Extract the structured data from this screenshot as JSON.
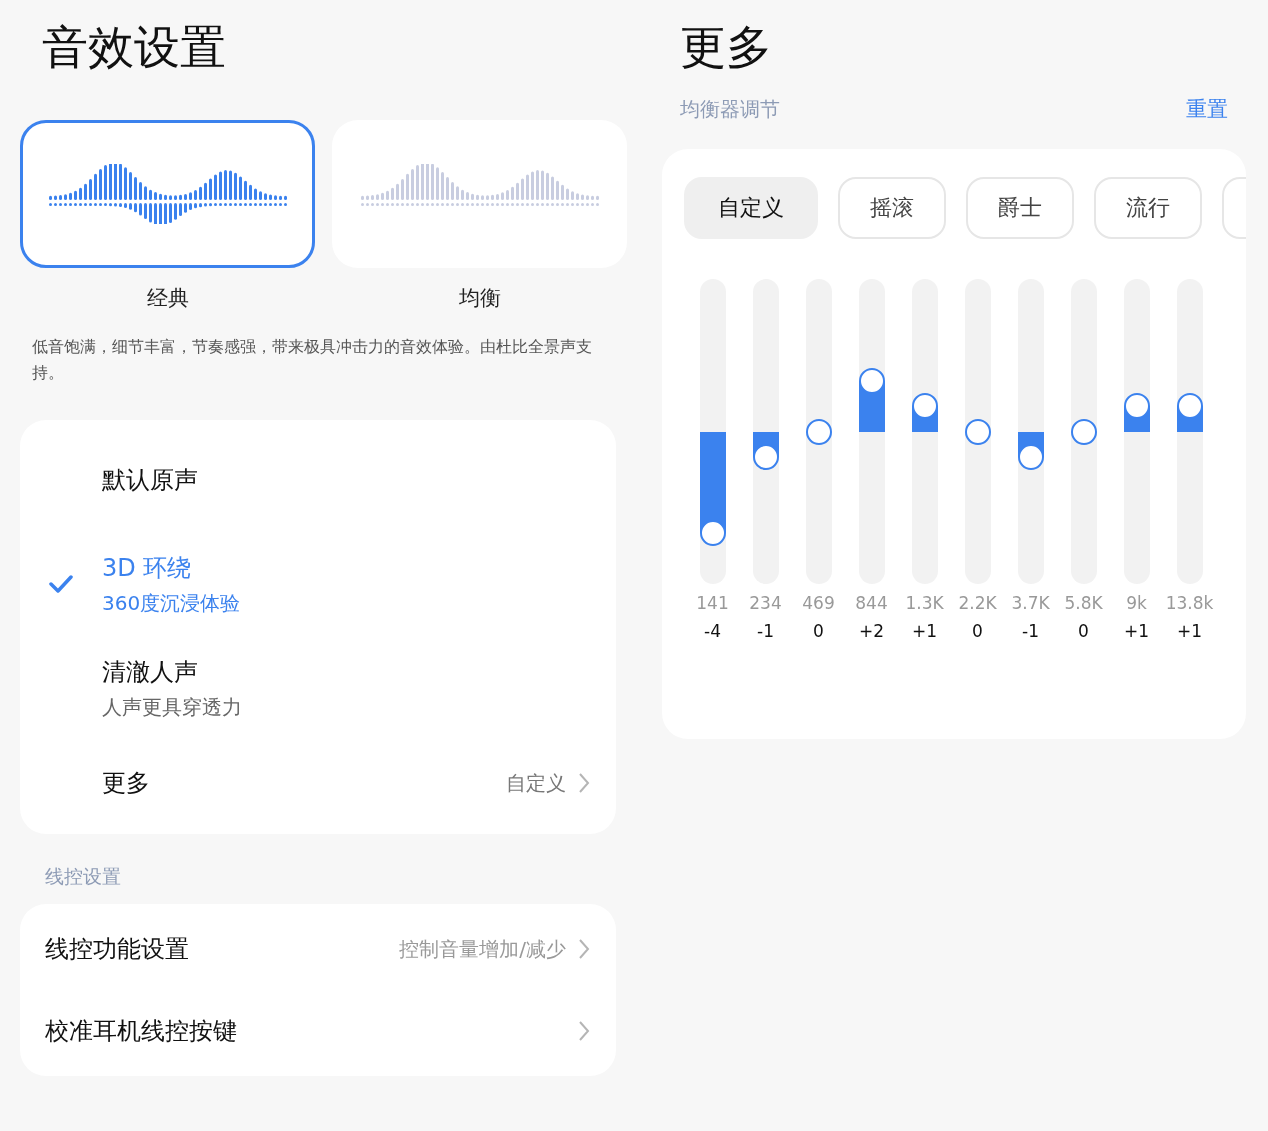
{
  "left": {
    "title": "音效设置",
    "styles": [
      {
        "label": "经典",
        "selected": true
      },
      {
        "label": "均衡",
        "selected": false
      }
    ],
    "description": "低音饱满，细节丰富，节奏感强，带来极具冲击力的音效体验。由杜比全景声支持。",
    "modes": [
      {
        "kind": "mode",
        "title": "默认原声",
        "selected": false
      },
      {
        "kind": "mode",
        "title": "3D 环绕",
        "subtitle": "360度沉浸体验",
        "selected": true
      },
      {
        "kind": "mode",
        "title": "清澈人声",
        "subtitle": "人声更具穿透力",
        "selected": false
      },
      {
        "kind": "link",
        "title": "更多",
        "value": "自定义"
      }
    ],
    "wire_section": "线控设置",
    "wire_rows": [
      {
        "title": "线控功能设置",
        "value": "控制音量增加/减少"
      },
      {
        "title": "校准耳机线控按键"
      }
    ]
  },
  "right": {
    "title": "更多",
    "eq_label": "均衡器调节",
    "reset": "重置",
    "presets": [
      {
        "label": "自定义",
        "selected": true
      },
      {
        "label": "摇滚",
        "selected": false
      },
      {
        "label": "爵士",
        "selected": false
      },
      {
        "label": "流行",
        "selected": false
      }
    ],
    "bands": [
      {
        "freq": "141",
        "gain": "-4",
        "level": 0.1667
      },
      {
        "freq": "234",
        "gain": "-1",
        "level": 0.4167
      },
      {
        "freq": "469",
        "gain": "0",
        "level": 0.5
      },
      {
        "freq": "844",
        "gain": "+2",
        "level": 0.6667
      },
      {
        "freq": "1.3K",
        "gain": "+1",
        "level": 0.5833
      },
      {
        "freq": "2.2K",
        "gain": "0",
        "level": 0.5
      },
      {
        "freq": "3.7K",
        "gain": "-1",
        "level": 0.4167
      },
      {
        "freq": "5.8K",
        "gain": "0",
        "level": 0.5
      },
      {
        "freq": "9k",
        "gain": "+1",
        "level": 0.5833
      },
      {
        "freq": "13.8k",
        "gain": "+1",
        "level": 0.5833
      }
    ]
  }
}
